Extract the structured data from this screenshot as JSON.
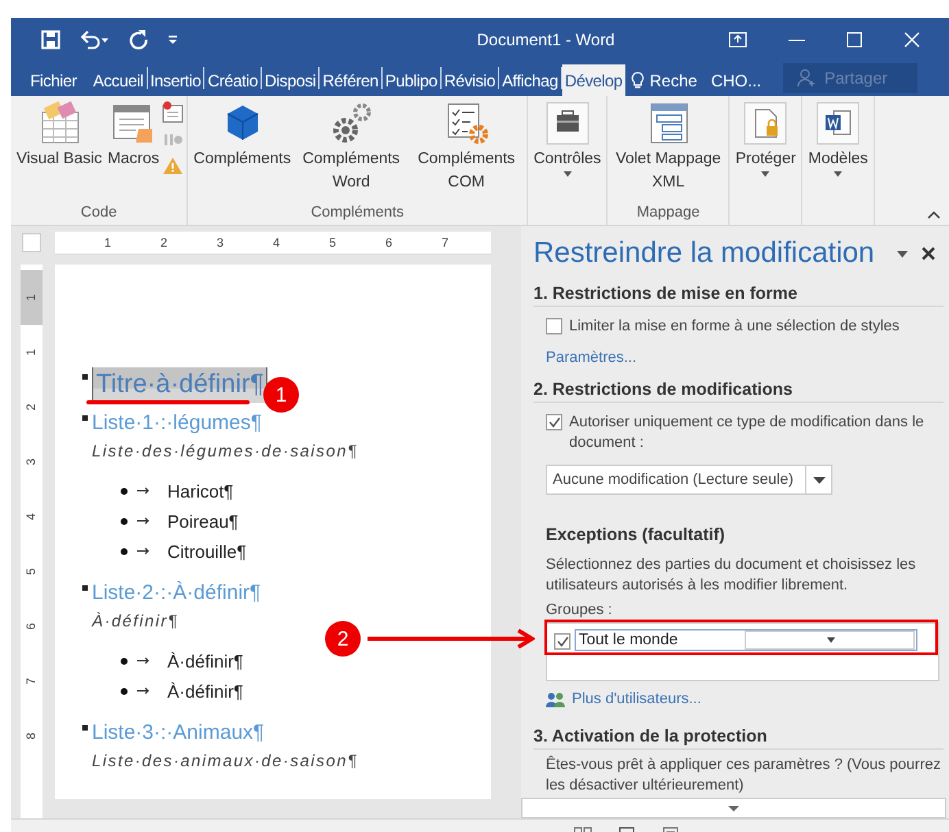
{
  "title_bar": {
    "title": "Document1 - Word"
  },
  "tabs": [
    {
      "label": "Fichier",
      "selected": false
    },
    {
      "label": "Accueil",
      "selected": false
    },
    {
      "label": "Insertio",
      "selected": false
    },
    {
      "label": "Créatio",
      "selected": false
    },
    {
      "label": "Disposi",
      "selected": false
    },
    {
      "label": "Référen",
      "selected": false
    },
    {
      "label": "Publipo",
      "selected": false
    },
    {
      "label": "Révisio",
      "selected": false
    },
    {
      "label": "Affichag",
      "selected": false
    },
    {
      "label": "Dévelop",
      "selected": true
    }
  ],
  "tell_me": "Reche",
  "user": "CHO...",
  "share": "Partager",
  "ribbon": [
    {
      "label": "Code",
      "buttons": [
        {
          "label": "Visual Basic"
        },
        {
          "label": "Macros"
        }
      ]
    },
    {
      "label": "Compléments",
      "buttons": [
        {
          "label": "Compléments"
        },
        {
          "label": "Compléments Word"
        },
        {
          "label": "Compléments COM"
        }
      ]
    },
    {
      "buttons": [
        {
          "label": "Contrôles",
          "dropdown": true
        }
      ]
    },
    {
      "label": "Mappage",
      "buttons": [
        {
          "label": "Volet Mappage XML"
        }
      ]
    },
    {
      "buttons": [
        {
          "label": "Protéger",
          "dropdown": true
        }
      ]
    },
    {
      "buttons": [
        {
          "label": "Modèles",
          "dropdown": true
        }
      ]
    }
  ],
  "ruler": {
    "horizontal": [
      "1",
      "2",
      "3",
      "4",
      "5",
      "6",
      "7"
    ],
    "vertical": [
      "1",
      "1",
      "2",
      "3",
      "4",
      "5",
      "6",
      "7",
      "8"
    ]
  },
  "document": [
    {
      "kind": "title",
      "text": "Titre·à·définir¶",
      "selected": true
    },
    {
      "kind": "list_heading",
      "text": "Liste·1·:·légumes¶"
    },
    {
      "kind": "subtitle",
      "text": "Liste·des·légumes·de·saison¶"
    },
    {
      "kind": "bullet",
      "text": "Haricot¶"
    },
    {
      "kind": "bullet",
      "text": "Poireau¶"
    },
    {
      "kind": "bullet",
      "text": "Citrouille¶"
    },
    {
      "kind": "list_heading",
      "text": "Liste·2·:·À·définir¶"
    },
    {
      "kind": "subtitle",
      "text": "À·définir¶"
    },
    {
      "kind": "bullet",
      "text": "À·définir¶"
    },
    {
      "kind": "bullet",
      "text": "À·définir¶"
    },
    {
      "kind": "list_heading",
      "text": "Liste·3·:·Animaux¶"
    },
    {
      "kind": "subtitle",
      "text": "Liste·des·animaux·de·saison¶"
    }
  ],
  "callouts": [
    {
      "number": "1"
    },
    {
      "number": "2"
    }
  ],
  "pane": {
    "title": "Restreindre la modification",
    "formatting": {
      "heading": "1. Restrictions de mise en forme",
      "checkbox": {
        "label": "Limiter la mise en forme à une sélection de styles",
        "checked": false
      },
      "link": "Paramètres..."
    },
    "editing": {
      "heading": "2. Restrictions de modifications",
      "checkbox": {
        "label": "Autoriser uniquement ce type de modification dans le document :",
        "checked": true
      },
      "dropdown": "Aucune modification (Lecture seule)"
    },
    "exceptions": {
      "heading": "Exceptions (facultatif)",
      "description": "Sélectionnez des parties du document et choisissez les utilisateurs autorisés à les modifier librement.",
      "groups_label": "Groupes :",
      "groups": [
        {
          "label": "Tout le monde",
          "checked": true
        }
      ],
      "link": "Plus d'utilisateurs..."
    },
    "protection": {
      "heading": "3. Activation de la protection",
      "description": "Êtes-vous prêt à appliquer ces paramètres ? (Vous pourrez les désactiver ultérieurement)"
    }
  }
}
